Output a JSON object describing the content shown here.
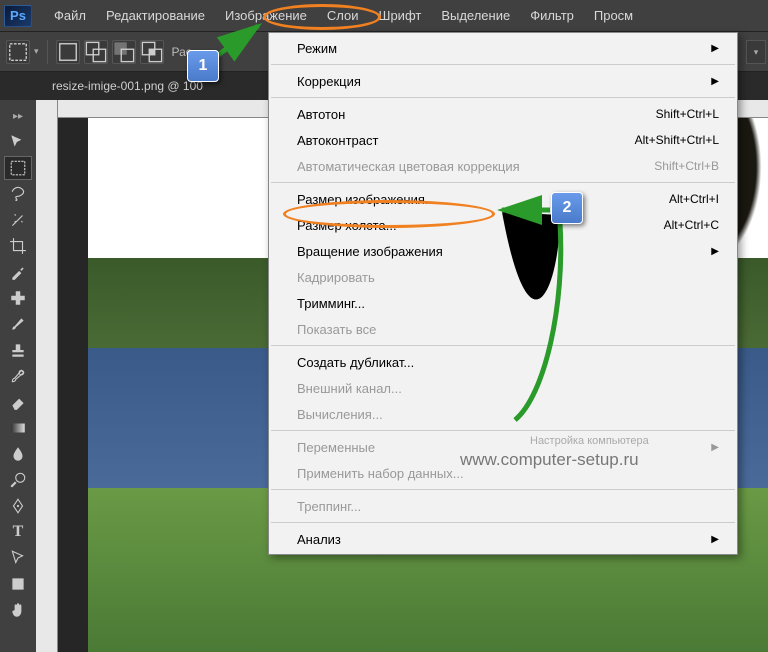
{
  "logo": "Ps",
  "menubar": {
    "file": "Файл",
    "edit": "Редактирование",
    "image": "Изображение",
    "layer": "Слои",
    "type": "Шрифт",
    "select": "Выделение",
    "filter": "Фильтр",
    "view": "Просм"
  },
  "toolbar": {
    "rast": "Рас"
  },
  "doc_tab": "resize-imige-001.png @ 100",
  "menu": {
    "mode": "Режим",
    "adjustments": "Коррекция",
    "auto_tone": "Автотон",
    "auto_tone_sc": "Shift+Ctrl+L",
    "auto_contrast": "Автоконтраст",
    "auto_contrast_sc": "Alt+Shift+Ctrl+L",
    "auto_color": "Автоматическая цветовая коррекция",
    "auto_color_sc": "Shift+Ctrl+B",
    "image_size": "Размер изображения...",
    "image_size_sc": "Alt+Ctrl+I",
    "canvas_size": "Размер холста...",
    "canvas_size_sc": "Alt+Ctrl+C",
    "rotation": "Вращение изображения",
    "crop": "Кадрировать",
    "trim": "Тримминг...",
    "reveal_all": "Показать все",
    "duplicate": "Создать дубликат...",
    "apply_image": "Внешний канал...",
    "calculations": "Вычисления...",
    "variables": "Переменные",
    "apply_data": "Применить набор данных...",
    "trap": "Треппинг...",
    "analysis": "Анализ"
  },
  "callouts": {
    "one": "1",
    "two": "2"
  },
  "watermark": {
    "line1": "Настройка компьютера",
    "line2": "www.computer-setup.ru"
  }
}
